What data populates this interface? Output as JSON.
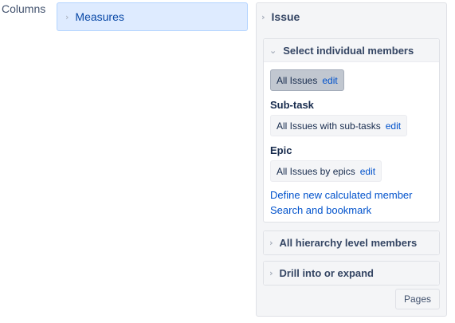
{
  "columns": {
    "label": "Columns"
  },
  "measures": {
    "label": "Measures",
    "chevron_icon": "chevron-right-icon"
  },
  "issue_panel": {
    "title": "Issue",
    "select_section": {
      "title": "Select individual members",
      "chevron_icon": "chevron-down-icon",
      "all_issues": {
        "label": "All Issues",
        "edit": "edit"
      },
      "groups": [
        {
          "title": "Sub-task",
          "member": "All Issues with sub-tasks",
          "edit": "edit"
        },
        {
          "title": "Epic",
          "member": "All Issues by epics",
          "edit": "edit"
        }
      ],
      "links": {
        "define": "Define new calculated member",
        "search": "Search and bookmark"
      }
    },
    "hierarchy_section": {
      "title": "All hierarchy level members",
      "chevron_icon": "chevron-right-icon"
    },
    "drill_section": {
      "title": "Drill into or expand",
      "chevron_icon": "chevron-right-icon"
    },
    "pages_button": "Pages"
  }
}
